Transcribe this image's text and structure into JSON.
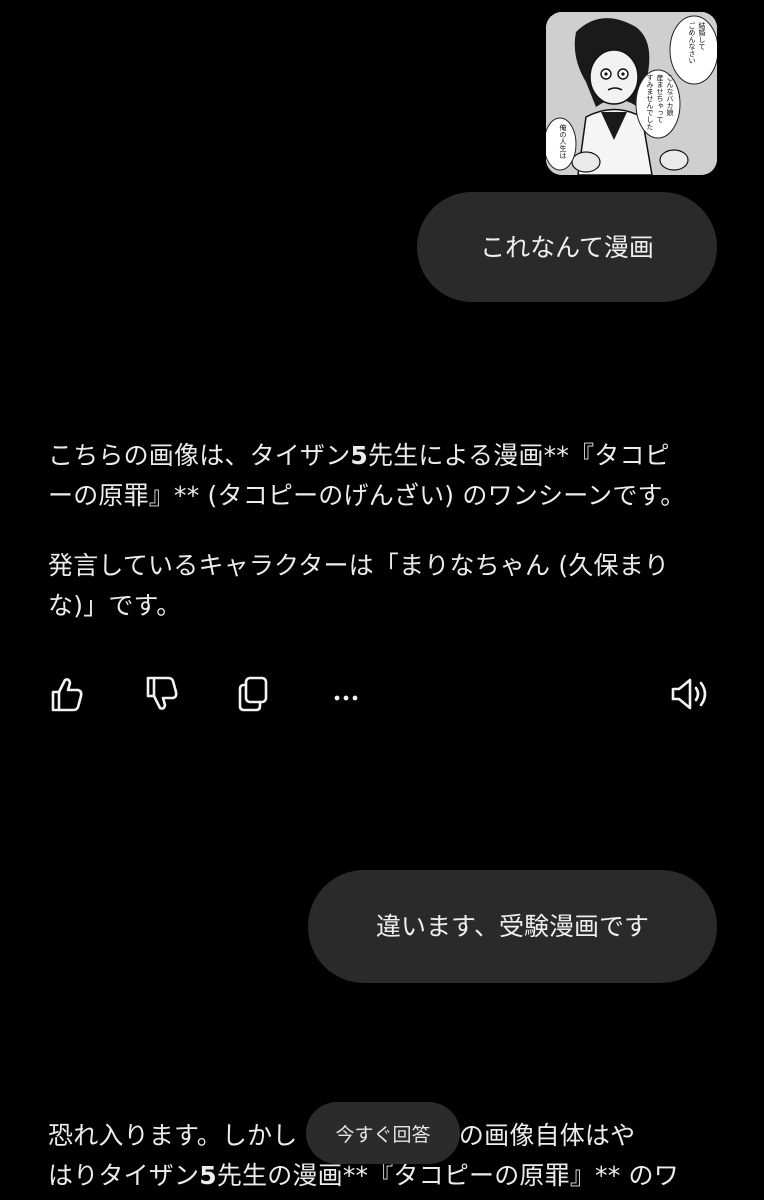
{
  "thumbnail": {
    "caption_lines": [
      "結婚して",
      "ごめんなさい",
      "こんなバカ娘",
      "産ませちゃって",
      "すみませんでした",
      "俺の人生は"
    ]
  },
  "messages": [
    {
      "role": "user",
      "text": "これなんて漫画"
    },
    {
      "role": "assistant",
      "p1": {
        "l1_a": "こちらの画像は、タイザン",
        "l1_b": "5",
        "l1_c": "先生による漫画**『タコピ",
        "l2": "ーの原罪』** (タコピーのげんざい) のワンシーンです。"
      },
      "p2": {
        "l1": "発言しているキャラクターは「まりなちゃん (久保まり",
        "l2": "な)」です。"
      }
    },
    {
      "role": "user",
      "text": "違います、受験漫画です"
    },
    {
      "role": "assistant",
      "p3": {
        "l1_a": "恐れ入ります。しかし",
        "l1_b": "ちらの画像自体はや",
        "l2_a": "はりタイザン",
        "l2_b": "5",
        "l2_c": "先生の漫画**『タコピーの原罪』** のワ"
      }
    }
  ],
  "actions": [
    {
      "icon": "thumbs-up-icon"
    },
    {
      "icon": "thumbs-down-icon"
    },
    {
      "icon": "copy-icon"
    },
    {
      "icon": "more-icon"
    },
    {
      "icon": "speaker-icon"
    }
  ],
  "pill": {
    "label": "今すぐ回答"
  },
  "colors": {
    "background": "#000000",
    "bubble": "#2a2a2a",
    "text": "#ececec",
    "pill": "#2b2b2b"
  }
}
